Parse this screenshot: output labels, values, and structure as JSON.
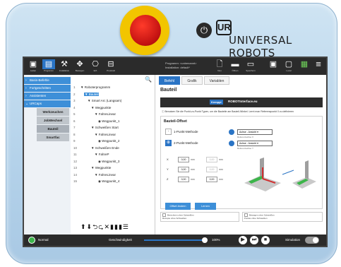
{
  "brand": {
    "logo_text": "UR",
    "name": "UNIVERSAL ROBOTS",
    "power_icon": "power-icon"
  },
  "topbar": {
    "icons": [
      {
        "name": "ur-home-icon",
        "glyph": "▣",
        "label": "Laden"
      },
      {
        "name": "program-icon",
        "glyph": "▤",
        "label": "Programm"
      },
      {
        "name": "installation-icon",
        "glyph": "⚒",
        "label": "Installation"
      },
      {
        "name": "move-icon",
        "glyph": "✥",
        "label": "Bewegen"
      },
      {
        "name": "io-icon",
        "glyph": "⎔",
        "label": "E/A"
      },
      {
        "name": "log-icon",
        "glyph": "⊟",
        "label": "Protokoll"
      }
    ],
    "program_line": "Programm: <unbenannt>",
    "installation_line": "Installation: default*",
    "file_icons": [
      {
        "name": "new-file-icon",
        "glyph": "🗋",
        "label": "Neu"
      },
      {
        "name": "open-folder-icon",
        "glyph": "▬",
        "label": "Öffnen"
      },
      {
        "name": "save-icon",
        "glyph": "▭",
        "label": "Speichern"
      }
    ],
    "right_icons": [
      {
        "name": "ur-cap-icon",
        "glyph": "▣",
        "label": ""
      },
      {
        "name": "safety-icon",
        "glyph": "▢",
        "label": "Local"
      },
      {
        "name": "status-grid-icon",
        "glyph": "▦",
        "label": ""
      },
      {
        "name": "menu-icon",
        "glyph": "≡",
        "label": ""
      }
    ]
  },
  "sidebar": {
    "items": [
      {
        "label": "Basis-Befehle"
      },
      {
        "label": "Fortgeschritten"
      },
      {
        "label": "Assistenten"
      },
      {
        "label": "URCaps"
      }
    ],
    "subitems": [
      {
        "label": "Werkzeuchen"
      },
      {
        "label": "JobWechsel"
      },
      {
        "label": "Bauteil"
      },
      {
        "label": "Smartfac"
      }
    ]
  },
  "tree": {
    "rows": [
      {
        "n": "1",
        "indent": 0,
        "text": "▼ Roboterprogramm"
      },
      {
        "n": "2",
        "indent": 1,
        "text": "▼ Bauteil",
        "selected": true
      },
      {
        "n": "3",
        "indent": 2,
        "text": "▼ Smart Arc (Langsam)"
      },
      {
        "n": "4",
        "indent": 3,
        "text": "▼ Wegpunkte"
      },
      {
        "n": "5",
        "indent": 4,
        "text": "▼ FahreLinear"
      },
      {
        "n": "6",
        "indent": 5,
        "text": "◉ Wegpunkt_1"
      },
      {
        "n": "7",
        "indent": 3,
        "text": "▼ Schweißen Start"
      },
      {
        "n": "8",
        "indent": 4,
        "text": "▼ FahreLinear"
      },
      {
        "n": "9",
        "indent": 5,
        "text": "◉ Wegpunkt_2"
      },
      {
        "n": "10",
        "indent": 3,
        "text": "▼ Schweißen Ende"
      },
      {
        "n": "11",
        "indent": 4,
        "text": "▼ FahreP"
      },
      {
        "n": "12",
        "indent": 5,
        "text": "◉ Wegpunkt_3"
      },
      {
        "n": "13",
        "indent": 3,
        "text": "▼ Wegpunkte"
      },
      {
        "n": "14",
        "indent": 4,
        "text": "▼ FahreLinear"
      },
      {
        "n": "15",
        "indent": 5,
        "text": "◉ Wegpunkt_4"
      }
    ],
    "tools": "⬆⬇⮌⮎✕▮▮▮☰"
  },
  "main": {
    "tabs": [
      {
        "label": "Befehl"
      },
      {
        "label": "Grafik"
      },
      {
        "label": "Variablen"
      }
    ],
    "section_title": "Bauteil",
    "banner_logo": "Kemppi",
    "banner_text": "ROBOTInterface.eu",
    "info": "ⓘ Benutzen Sie die Punkt-zu-Punkt Typen, um die Bauteile am Bauteil-Winkel. Lernt man Referenzpunkt 0 zu definieren",
    "panel_title": "Bauteil-Offset",
    "method1": "1-Punkt-Methode",
    "method2": "2-Punkt-Methode",
    "dd1": "Achse - Ansicht ▾",
    "dd1_sub": "Referenzachse X",
    "dd2": "Achse - Ansicht ▾",
    "dd2_sub": "Referenzachse Y",
    "rows": [
      {
        "axis": "X",
        "v1": "0,00",
        "v2": "0,00",
        "u1": "mm",
        "u2": "mm"
      },
      {
        "axis": "Y",
        "v1": "0,00",
        "v2": "0,00",
        "u1": "mm",
        "u2": "mm"
      },
      {
        "axis": "Z",
        "v1": "0,00",
        "v2": "0,00",
        "u1": "mm",
        "u2": "mm"
      }
    ],
    "btn1": "Offset ändern",
    "btn2": "Lernen",
    "foot1": "Berechnen ohne Schweißen",
    "foot1_sub": "Rezepte ohne Schweißen",
    "foot2": "Bewegen ohne Schweißen",
    "foot2_sub": "Punkte ohne Schweißen"
  },
  "bottombar": {
    "status": "Normal",
    "speed_label": "Geschwindigkeit",
    "speed_value": "100%",
    "speed_fraction": 0.95,
    "play": "▶",
    "step": "⏭",
    "stop": "■",
    "simulation": "Simulation"
  }
}
